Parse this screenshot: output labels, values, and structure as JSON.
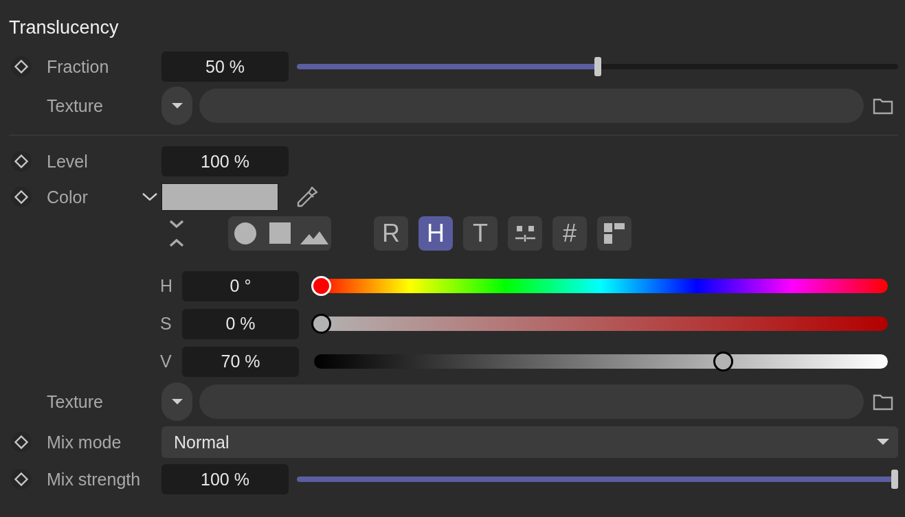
{
  "section_title": "Translucency",
  "rows": [
    {
      "kind": "slider",
      "label": "Fraction",
      "animatable": true,
      "value": "50 %",
      "level": 0.5
    },
    {
      "kind": "texture",
      "label": "Texture",
      "animatable": false
    },
    {
      "kind": "divider"
    },
    {
      "kind": "number",
      "label": "Level",
      "animatable": true,
      "value": "100 %"
    },
    {
      "kind": "color",
      "label": "Color",
      "animatable": true,
      "expanded": true,
      "modes": [
        {
          "kind": "text",
          "label": "R",
          "selected": false
        },
        {
          "kind": "text",
          "label": "H",
          "selected": true
        },
        {
          "kind": "text",
          "label": "T",
          "selected": false
        },
        {
          "kind": "sliders",
          "selected": false
        },
        {
          "kind": "text",
          "label": "#",
          "selected": false
        },
        {
          "kind": "swatches",
          "selected": false
        }
      ],
      "channels": [
        {
          "kind": "hue",
          "label": "H",
          "value": "0 °",
          "level": 0
        },
        {
          "kind": "saturation",
          "label": "S",
          "value": "0 %",
          "level": 0
        },
        {
          "kind": "value",
          "label": "V",
          "value": "70 %",
          "level": 0.7
        }
      ]
    },
    {
      "kind": "texture",
      "label": "Texture",
      "animatable": false
    },
    {
      "kind": "dropdown",
      "label": "Mix mode",
      "animatable": true,
      "value": "Normal"
    },
    {
      "kind": "slider",
      "label": "Mix strength",
      "animatable": true,
      "value": "100 %",
      "level": 1
    }
  ]
}
